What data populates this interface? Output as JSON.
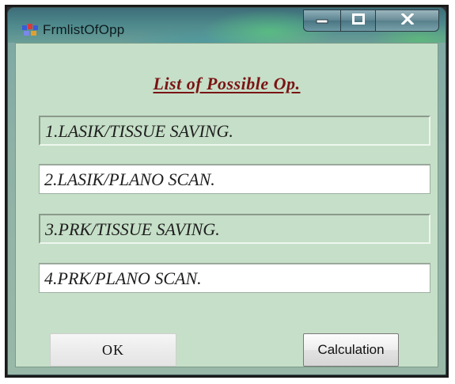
{
  "window": {
    "title": "FrmlistOfOpp",
    "app_icon": "vb-form-icon",
    "controls": {
      "minimize_icon": "minimize-icon",
      "maximize_icon": "maximize-icon",
      "close_icon": "close-icon"
    }
  },
  "form": {
    "heading": "List of  Possible Op.",
    "heading_color": "#7a1414",
    "background_color": "#c6dfc8",
    "options": [
      {
        "label": "1.LASIK/TISSUE SAVING.",
        "style": "sunken"
      },
      {
        "label": "2.LASIK/PLANO SCAN.",
        "style": "white"
      },
      {
        "label": "3.PRK/TISSUE SAVING.",
        "style": "sunken"
      },
      {
        "label": "4.PRK/PLANO SCAN.",
        "style": "white"
      }
    ],
    "ok_label": "OK",
    "calculation_label": "Calculation"
  }
}
